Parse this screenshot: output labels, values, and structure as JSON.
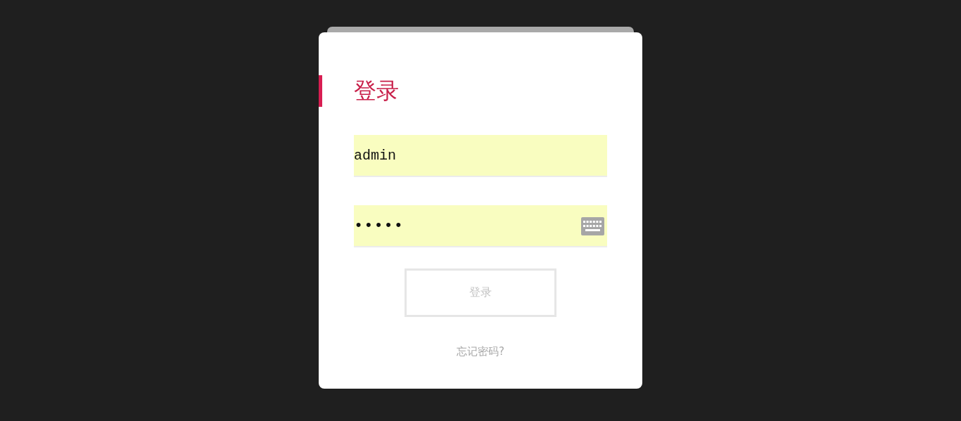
{
  "title": "登录",
  "username": {
    "value": "admin"
  },
  "password": {
    "value": "•••••"
  },
  "submit": {
    "label": "登录",
    "disabled": true
  },
  "forgot_link": "忘记密码?"
}
